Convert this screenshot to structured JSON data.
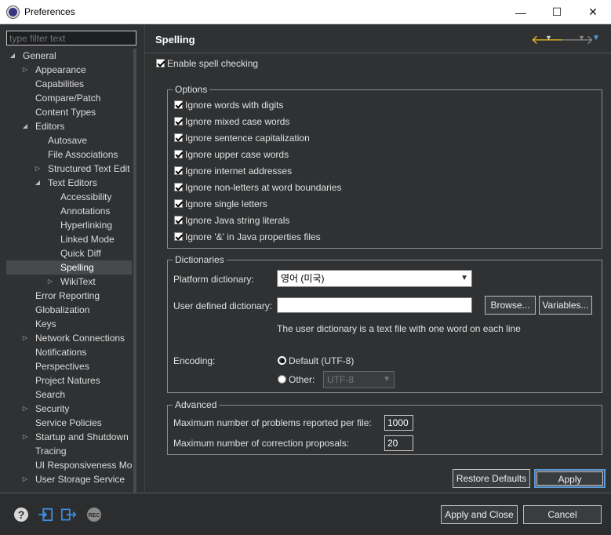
{
  "window": {
    "title": "Preferences",
    "minimize": "—",
    "maximize": "☐",
    "close": "✕"
  },
  "filter": {
    "placeholder": "type filter text"
  },
  "tree": [
    {
      "label": "General",
      "level": 0,
      "arrow": "expanded"
    },
    {
      "label": "Appearance",
      "level": 1,
      "arrow": "collapsed"
    },
    {
      "label": "Capabilities",
      "level": 1,
      "arrow": "none"
    },
    {
      "label": "Compare/Patch",
      "level": 1,
      "arrow": "none"
    },
    {
      "label": "Content Types",
      "level": 1,
      "arrow": "none"
    },
    {
      "label": "Editors",
      "level": 1,
      "arrow": "expanded"
    },
    {
      "label": "Autosave",
      "level": 2,
      "arrow": "none"
    },
    {
      "label": "File Associations",
      "level": 2,
      "arrow": "none"
    },
    {
      "label": "Structured Text Edit",
      "level": 2,
      "arrow": "collapsed"
    },
    {
      "label": "Text Editors",
      "level": 2,
      "arrow": "expanded"
    },
    {
      "label": "Accessibility",
      "level": 3,
      "arrow": "none"
    },
    {
      "label": "Annotations",
      "level": 3,
      "arrow": "none"
    },
    {
      "label": "Hyperlinking",
      "level": 3,
      "arrow": "none"
    },
    {
      "label": "Linked Mode",
      "level": 3,
      "arrow": "none"
    },
    {
      "label": "Quick Diff",
      "level": 3,
      "arrow": "none"
    },
    {
      "label": "Spelling",
      "level": 3,
      "arrow": "none",
      "selected": true
    },
    {
      "label": "WikiText",
      "level": 3,
      "arrow": "collapsed"
    },
    {
      "label": "Error Reporting",
      "level": 1,
      "arrow": "none"
    },
    {
      "label": "Globalization",
      "level": 1,
      "arrow": "none"
    },
    {
      "label": "Keys",
      "level": 1,
      "arrow": "none"
    },
    {
      "label": "Network Connections",
      "level": 1,
      "arrow": "collapsed"
    },
    {
      "label": "Notifications",
      "level": 1,
      "arrow": "none"
    },
    {
      "label": "Perspectives",
      "level": 1,
      "arrow": "none"
    },
    {
      "label": "Project Natures",
      "level": 1,
      "arrow": "none"
    },
    {
      "label": "Search",
      "level": 1,
      "arrow": "none"
    },
    {
      "label": "Security",
      "level": 1,
      "arrow": "collapsed"
    },
    {
      "label": "Service Policies",
      "level": 1,
      "arrow": "none"
    },
    {
      "label": "Startup and Shutdown",
      "level": 1,
      "arrow": "collapsed"
    },
    {
      "label": "Tracing",
      "level": 1,
      "arrow": "none"
    },
    {
      "label": "UI Responsiveness Mor",
      "level": 1,
      "arrow": "none"
    },
    {
      "label": "User Storage Service",
      "level": 1,
      "arrow": "collapsed"
    }
  ],
  "page": {
    "title": "Spelling"
  },
  "enable_spell": "Enable spell checking",
  "options": {
    "legend": "Options",
    "items": [
      "Ignore words with digits",
      "Ignore mixed case words",
      "Ignore sentence capitalization",
      "Ignore upper case words",
      "Ignore internet addresses",
      "Ignore non-letters at word boundaries",
      "Ignore single letters",
      "Ignore Java string literals",
      "Ignore '&' in Java properties files"
    ]
  },
  "dictionaries": {
    "legend": "Dictionaries",
    "platform_label": "Platform dictionary:",
    "platform_value": "영어 (미국)",
    "user_label": "User defined dictionary:",
    "user_value": "",
    "browse": "Browse...",
    "variables": "Variables...",
    "hint": "The user dictionary is a text file with one word on each line",
    "encoding_label": "Encoding:",
    "default_encoding": "Default (UTF-8)",
    "other_label": "Other:",
    "other_value": "UTF-8"
  },
  "advanced": {
    "legend": "Advanced",
    "max_problems_label": "Maximum number of problems reported per file:",
    "max_problems_value": "1000",
    "max_proposals_label": "Maximum number of correction proposals:",
    "max_proposals_value": "20"
  },
  "buttons": {
    "restore": "Restore Defaults",
    "apply": "Apply",
    "apply_close": "Apply and Close",
    "cancel": "Cancel"
  },
  "colors": {
    "back_arrow": "#f0c020",
    "accent": "#5b9bd5"
  }
}
